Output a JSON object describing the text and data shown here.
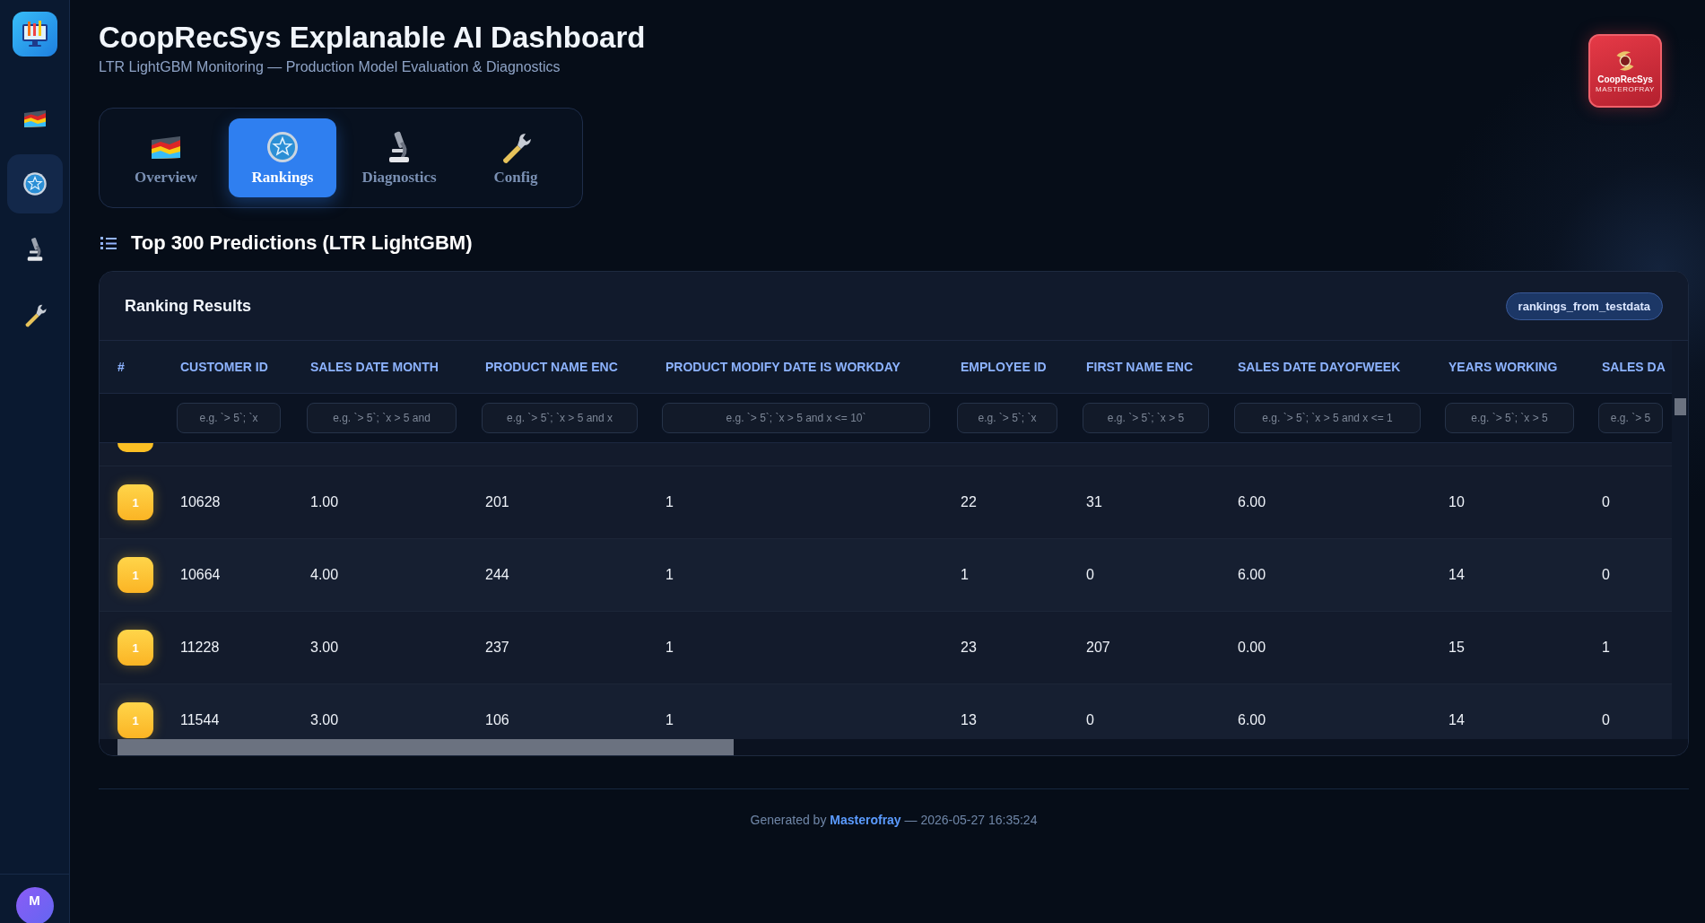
{
  "sidebar": {
    "items": [
      {
        "selected": false
      },
      {
        "selected": true
      },
      {
        "selected": false
      },
      {
        "selected": false
      }
    ],
    "avatar": "M"
  },
  "header": {
    "title": "CoopRecSys Explanable AI Dashboard",
    "subtitle": "LTR LightGBM Monitoring — Production Model Evaluation & Diagnostics"
  },
  "brand_logo": {
    "name": "CoopRecSys",
    "tagline": "MASTEROFRAY"
  },
  "tabs": [
    {
      "label": "Overview",
      "selected": false
    },
    {
      "label": "Rankings",
      "selected": true
    },
    {
      "label": "Diagnostics",
      "selected": false
    },
    {
      "label": "Config",
      "selected": false
    }
  ],
  "section_title": "Top 300 Predictions (LTR LightGBM)",
  "card": {
    "title": "Ranking Results",
    "badge": "rankings_from_testdata"
  },
  "table": {
    "columns": [
      {
        "label": "#"
      },
      {
        "label": "CUSTOMER ID",
        "placeholder": "e.g. `> 5`; `x"
      },
      {
        "label": "SALES DATE MONTH",
        "placeholder": "e.g. `> 5`; `x > 5 and"
      },
      {
        "label": "PRODUCT NAME ENC",
        "placeholder": "e.g. `> 5`; `x > 5 and x"
      },
      {
        "label": "PRODUCT MODIFY DATE IS WORKDAY",
        "placeholder": "e.g. `> 5`; `x > 5 and x <= 10`"
      },
      {
        "label": "EMPLOYEE ID",
        "placeholder": "e.g. `> 5`; `x"
      },
      {
        "label": "FIRST NAME ENC",
        "placeholder": "e.g. `> 5`; `x > 5"
      },
      {
        "label": "SALES DATE DAYOFWEEK",
        "placeholder": "e.g. `> 5`; `x > 5 and x <= 1"
      },
      {
        "label": "YEARS WORKING",
        "placeholder": "e.g. `> 5`; `x > 5"
      },
      {
        "label": "SALES DA",
        "placeholder": "e.g. `> 5"
      }
    ],
    "rows": [
      {
        "cells": [
          "1",
          "10628",
          "1.00",
          "201",
          "1",
          "22",
          "31",
          "6.00",
          "10",
          "0"
        ]
      },
      {
        "cells": [
          "1",
          "10664",
          "4.00",
          "244",
          "1",
          "1",
          "0",
          "6.00",
          "14",
          "0"
        ]
      },
      {
        "cells": [
          "1",
          "11228",
          "3.00",
          "237",
          "1",
          "23",
          "207",
          "0.00",
          "15",
          "1"
        ]
      },
      {
        "cells": [
          "1",
          "11544",
          "3.00",
          "106",
          "1",
          "13",
          "0",
          "6.00",
          "14",
          "0"
        ]
      }
    ]
  },
  "footer": {
    "lead": "Generated by",
    "link": "Masterofray",
    "tail": "— 2026-05-27 16:35:24"
  }
}
